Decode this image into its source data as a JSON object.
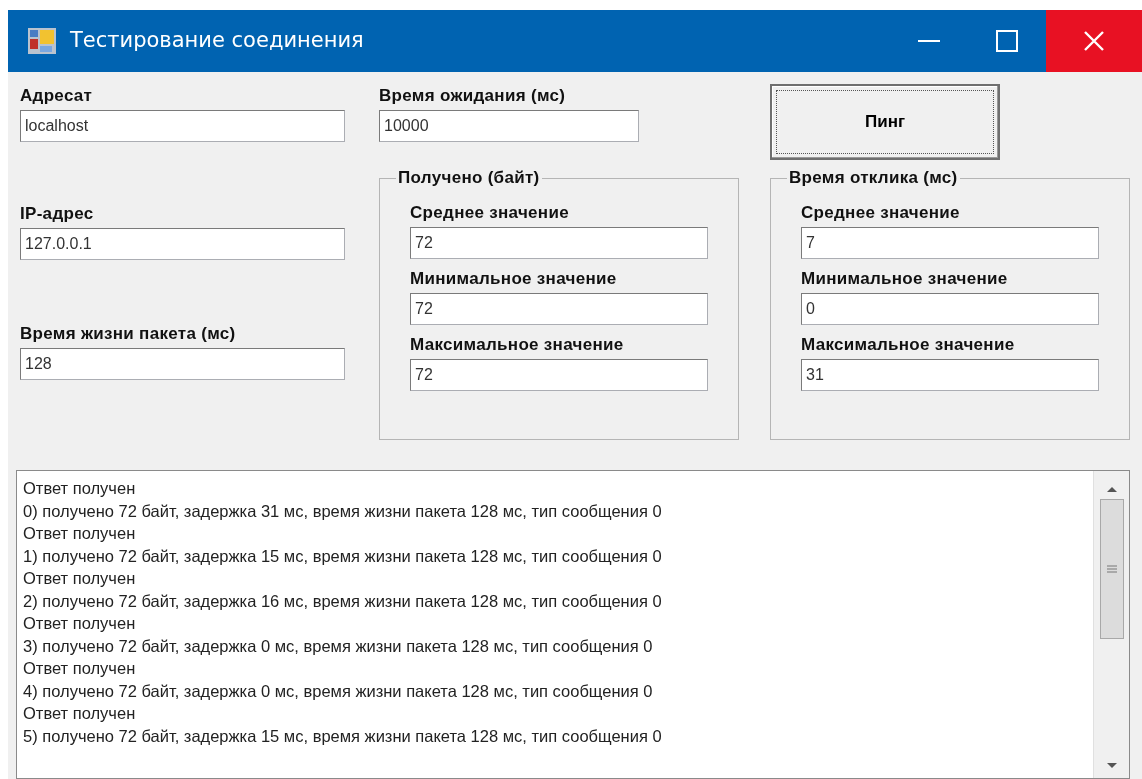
{
  "window": {
    "title": "Тестирование соединения"
  },
  "destination": {
    "label": "Адресат",
    "value": "localhost"
  },
  "timeout": {
    "label": "Время ожидания (мс)",
    "value": "10000"
  },
  "ping_button": {
    "label": "Пинг"
  },
  "ip_address": {
    "label": "IP-адрес",
    "value": "127.0.0.1"
  },
  "ttl": {
    "label": "Время жизни пакета (мс)",
    "value": "128"
  },
  "groups": [
    {
      "title": "Получено (байт)",
      "fields": [
        {
          "label": "Среднее значение",
          "value": "72"
        },
        {
          "label": "Минимальное значение",
          "value": "72"
        },
        {
          "label": "Максимальное значение",
          "value": "72"
        }
      ]
    },
    {
      "title": "Время отклика (мс)",
      "fields": [
        {
          "label": "Среднее значение",
          "value": "7"
        },
        {
          "label": "Минимальное значение",
          "value": "0"
        },
        {
          "label": "Максимальное значение",
          "value": "31"
        }
      ]
    }
  ],
  "log": {
    "lines": [
      "Ответ получен",
      "0) получено 72 байт, задержка 31 мс, время жизни пакета 128 мс, тип сообщения 0",
      "Ответ получен",
      "1) получено 72 байт, задержка 15 мс, время жизни пакета 128 мс, тип сообщения 0",
      "Ответ получен",
      "2) получено 72 байт, задержка 16 мс, время жизни пакета 128 мс, тип сообщения 0",
      "Ответ получен",
      "3) получено 72 байт, задержка 0 мс, время жизни пакета 128 мс, тип сообщения 0",
      "Ответ получен",
      "4) получено 72 байт, задержка 0 мс, время жизни пакета 128 мс, тип сообщения 0",
      "Ответ получен",
      "5) получено 72 байт, задержка 15 мс, время жизни пакета 128 мс, тип сообщения 0"
    ]
  }
}
